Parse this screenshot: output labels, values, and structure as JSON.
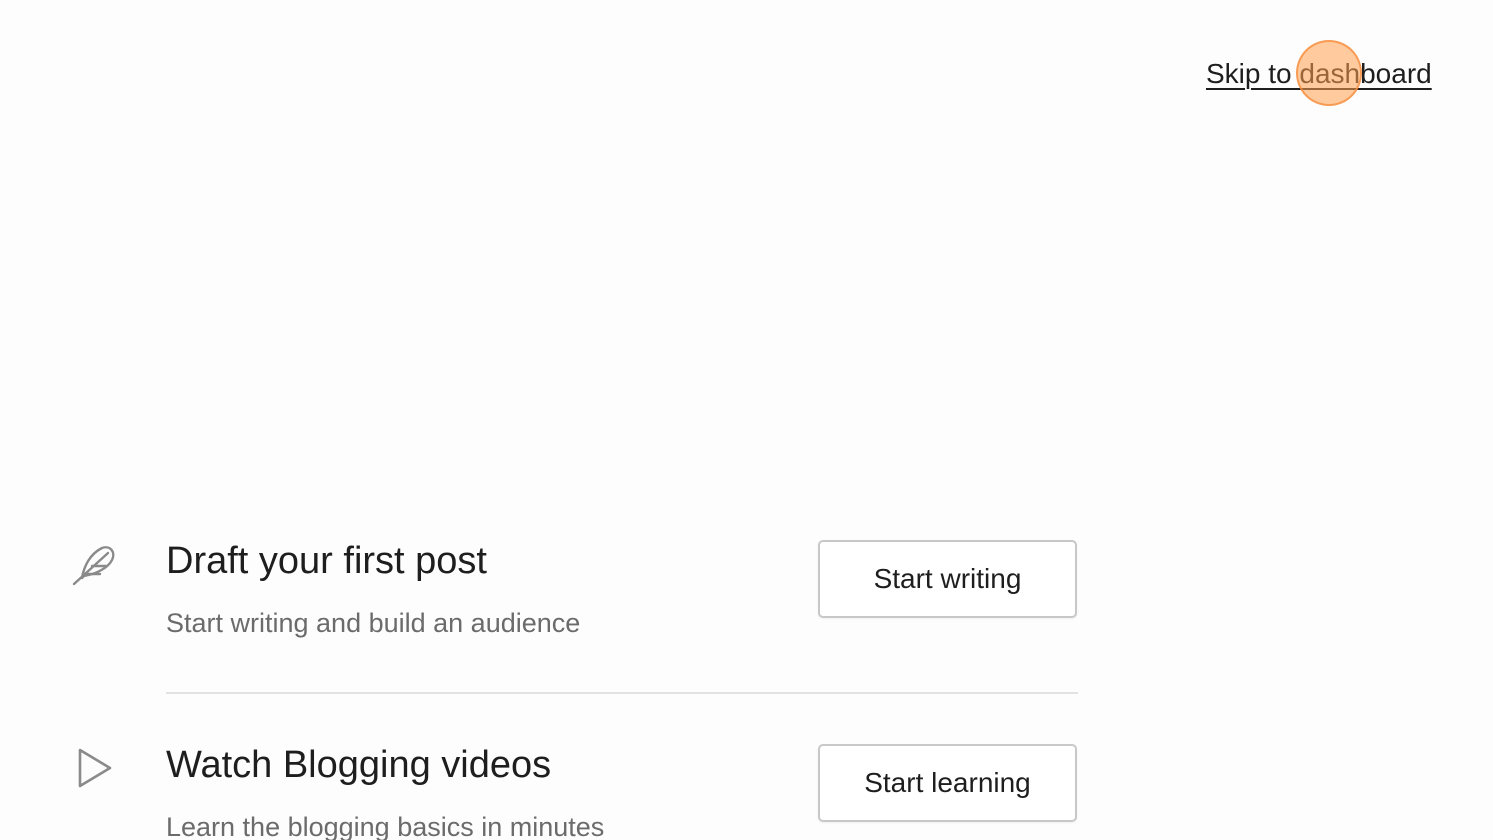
{
  "header": {
    "skip_link": "Skip to dashboard"
  },
  "rows": [
    {
      "icon": "feather-icon",
      "title": "Draft your first post",
      "description": "Start writing and build an audience",
      "button": "Start writing"
    },
    {
      "icon": "play-icon",
      "title": "Watch Blogging videos",
      "description": "Learn the blogging basics in minutes",
      "button": "Start learning"
    }
  ],
  "colors": {
    "background": "#fdfdfd",
    "text": "#1e1e1e",
    "muted_text": "#6b6b6b",
    "icon": "#8a8a8a",
    "click_marker": "#ffa050"
  }
}
